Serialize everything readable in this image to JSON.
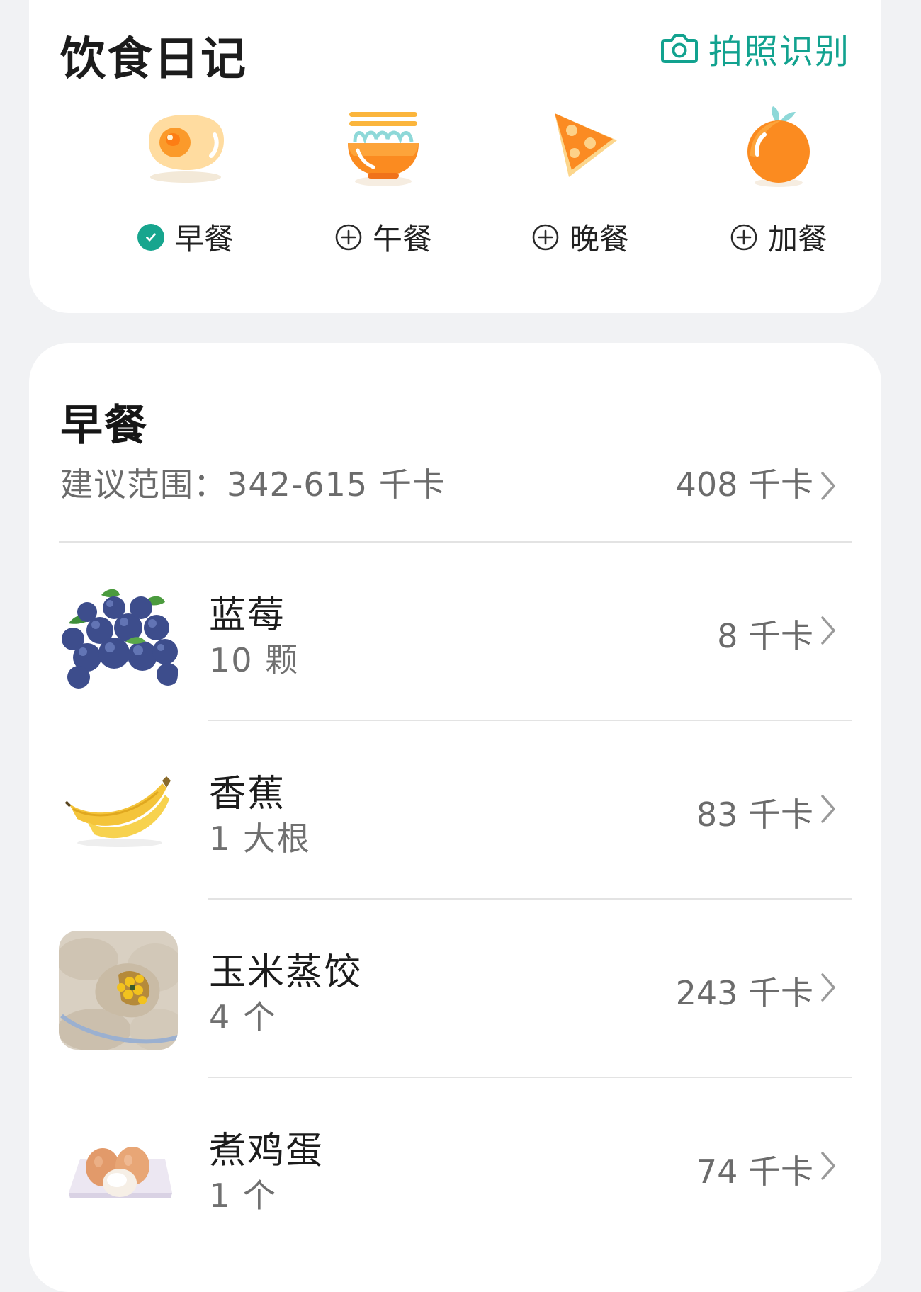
{
  "header": {
    "title": "饮食日记",
    "photo_button": "拍照识别"
  },
  "meal_types": [
    {
      "label": "早餐",
      "status": "checked",
      "icon": "egg-icon"
    },
    {
      "label": "午餐",
      "status": "add",
      "icon": "noodle-bowl-icon"
    },
    {
      "label": "晚餐",
      "status": "add",
      "icon": "pizza-slice-icon"
    },
    {
      "label": "加餐",
      "status": "add",
      "icon": "orange-fruit-icon"
    }
  ],
  "meal": {
    "title": "早餐",
    "range_text": "建议范围：342-615 千卡",
    "total_text": "408 千卡",
    "foods": [
      {
        "name": "蓝莓",
        "amount": "10 颗",
        "kcal": "8 千卡",
        "image": "blueberries-photo"
      },
      {
        "name": "香蕉",
        "amount": "1 大根",
        "kcal": "83 千卡",
        "image": "banana-photo"
      },
      {
        "name": "玉米蒸饺",
        "amount": "4 个",
        "kcal": "243 千卡",
        "image": "corn-dumplings-photo"
      },
      {
        "name": "煮鸡蛋",
        "amount": "1 个",
        "kcal": "74 千卡",
        "image": "boiled-eggs-photo"
      }
    ]
  },
  "colors": {
    "accent": "#17a58e",
    "background": "#f1f2f4",
    "card": "#ffffff",
    "secondary_text": "#6b6b6b"
  }
}
